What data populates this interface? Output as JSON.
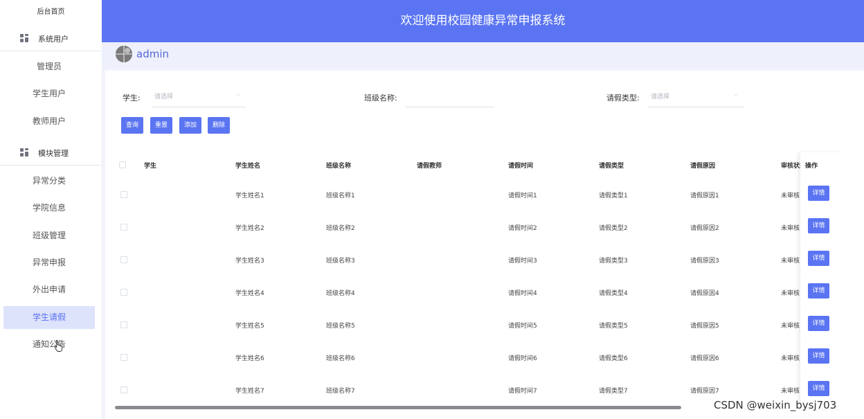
{
  "sidebar": {
    "home": "后台首页",
    "groups": [
      {
        "label": "系统用户",
        "items": [
          "管理员",
          "学生用户",
          "教师用户"
        ]
      },
      {
        "label": "模块管理",
        "items": [
          "异常分类",
          "学院信息",
          "班级管理",
          "异常申报",
          "外出申请",
          "学生请假",
          "通知公告"
        ]
      }
    ],
    "active": "学生请假"
  },
  "header": {
    "title": "欢迎使用校园健康异常申报系统"
  },
  "user": {
    "name": "admin"
  },
  "filters": {
    "student_label": "学生:",
    "student_placeholder": "请选择",
    "class_label": "班级名称:",
    "class_value": "",
    "leave_type_label": "请假类型:",
    "leave_type_placeholder": "请选择"
  },
  "buttons": {
    "query": "查询",
    "reset": "重置",
    "add": "添加",
    "delete": "删除"
  },
  "table": {
    "columns": [
      "学生",
      "学生姓名",
      "班级名称",
      "请假教师",
      "请假时间",
      "请假类型",
      "请假原因",
      "审核状态",
      "操作"
    ],
    "rows": [
      {
        "student": "",
        "name": "学生姓名1",
        "class": "班级名称1",
        "teacher": "",
        "time": "请假时间1",
        "type": "请假类型1",
        "reason": "请假原因1",
        "status": "未审核",
        "action": "详情"
      },
      {
        "student": "",
        "name": "学生姓名2",
        "class": "班级名称2",
        "teacher": "",
        "time": "请假时间2",
        "type": "请假类型2",
        "reason": "请假原因2",
        "status": "未审核",
        "action": "详情"
      },
      {
        "student": "",
        "name": "学生姓名3",
        "class": "班级名称3",
        "teacher": "",
        "time": "请假时间3",
        "type": "请假类型3",
        "reason": "请假原因3",
        "status": "未审核",
        "action": "详情"
      },
      {
        "student": "",
        "name": "学生姓名4",
        "class": "班级名称4",
        "teacher": "",
        "time": "请假时间4",
        "type": "请假类型4",
        "reason": "请假原因4",
        "status": "未审核",
        "action": "详情"
      },
      {
        "student": "",
        "name": "学生姓名5",
        "class": "班级名称5",
        "teacher": "",
        "time": "请假时间5",
        "type": "请假类型5",
        "reason": "请假原因5",
        "status": "未审核",
        "action": "详情"
      },
      {
        "student": "",
        "name": "学生姓名6",
        "class": "班级名称6",
        "teacher": "",
        "time": "请假时间6",
        "type": "请假类型6",
        "reason": "请假原因6",
        "status": "未审核",
        "action": "详情"
      },
      {
        "student": "",
        "name": "学生姓名7",
        "class": "班级名称7",
        "teacher": "",
        "time": "请假时间7",
        "type": "请假类型7",
        "reason": "请假原因7",
        "status": "未审核",
        "action": "详情"
      }
    ]
  },
  "watermark": "CSDN @weixin_bysj703",
  "colors": {
    "primary": "#5a74f2",
    "active_bg": "#dde3fb",
    "page_bg": "#f3f4fb"
  }
}
